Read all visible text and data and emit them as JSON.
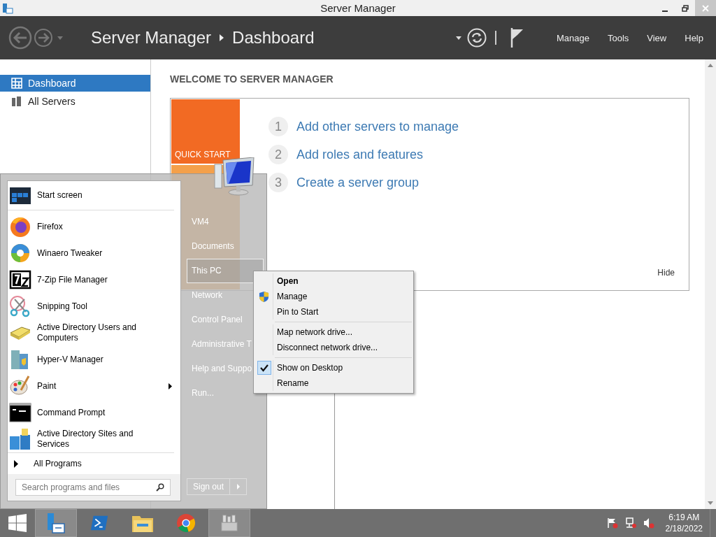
{
  "window": {
    "title": "Server Manager"
  },
  "header": {
    "breadcrumb": [
      "Server Manager",
      "Dashboard"
    ],
    "menu": [
      "Manage",
      "Tools",
      "View",
      "Help"
    ]
  },
  "sidebar": {
    "items": [
      {
        "label": "Dashboard",
        "selected": true
      },
      {
        "label": "All Servers",
        "selected": false
      }
    ]
  },
  "welcome": {
    "heading": "WELCOME TO SERVER MANAGER",
    "tile": "QUICK START",
    "steps": [
      {
        "number": "1",
        "label": "Add other servers to manage"
      },
      {
        "number": "2",
        "label": "Add roles and features"
      },
      {
        "number": "3",
        "label": "Create a server group"
      }
    ],
    "hide": "Hide"
  },
  "start_menu": {
    "programs": [
      {
        "label": "Start screen",
        "submenu": false
      },
      {
        "label": "Firefox",
        "submenu": false
      },
      {
        "label": "Winaero Tweaker",
        "submenu": false
      },
      {
        "label": "7-Zip File Manager",
        "submenu": false
      },
      {
        "label": "Snipping Tool",
        "submenu": false
      },
      {
        "label": "Active Directory Users and Computers",
        "submenu": false
      },
      {
        "label": "Hyper-V Manager",
        "submenu": false
      },
      {
        "label": "Paint",
        "submenu": true
      },
      {
        "label": "Command Prompt",
        "submenu": false
      },
      {
        "label": "Active Directory Sites and Services",
        "submenu": false
      }
    ],
    "all_programs": "All Programs",
    "search": {
      "placeholder": "Search programs and files"
    },
    "places": [
      {
        "label": "VM4",
        "selected": false
      },
      {
        "label": "Documents",
        "selected": false
      },
      {
        "label": "This PC",
        "selected": true
      },
      {
        "label": "Network",
        "selected": false
      },
      {
        "label": "Control Panel",
        "selected": false
      },
      {
        "label": "Administrative T",
        "selected": false
      },
      {
        "label": "Help and Suppo",
        "selected": false
      },
      {
        "label": "Run...",
        "selected": false
      }
    ],
    "sign_out": "Sign out"
  },
  "context_menu": {
    "groups": [
      [
        {
          "label": "Open",
          "default": true,
          "elevated": false,
          "checked": false
        },
        {
          "label": "Manage",
          "default": false,
          "elevated": true,
          "checked": false
        },
        {
          "label": "Pin to Start",
          "default": false,
          "elevated": false,
          "checked": false
        }
      ],
      [
        {
          "label": "Map network drive...",
          "default": false,
          "elevated": false,
          "checked": false
        },
        {
          "label": "Disconnect network drive...",
          "default": false,
          "elevated": false,
          "checked": false
        }
      ],
      [
        {
          "label": "Show on Desktop",
          "default": false,
          "elevated": false,
          "checked": true
        },
        {
          "label": "Rename",
          "default": false,
          "elevated": false,
          "checked": false
        }
      ]
    ]
  },
  "taskbar": {
    "apps": [
      {
        "active": true
      },
      {
        "active": false
      },
      {
        "active": false
      },
      {
        "active": false
      },
      {
        "active": true
      }
    ],
    "time": "6:19 AM",
    "date": "2/18/2022"
  }
}
